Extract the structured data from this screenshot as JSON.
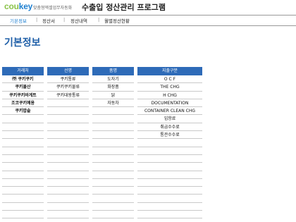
{
  "header": {
    "logo_main": "cou",
    "logo_accent": "key",
    "tagline": "맞춤형엑셀업무자동화",
    "title": "수출입 정산관리 프로그램"
  },
  "nav": {
    "items": [
      {
        "label": "기본정보",
        "active": true
      },
      {
        "label": "정산서"
      },
      {
        "label": "정산내역"
      },
      {
        "label": "월별정산현황"
      }
    ],
    "separator": "|"
  },
  "page": {
    "title": "기본정보"
  },
  "tables": [
    {
      "header": "거래처",
      "rows": [
        "㈜ 쿠키쿠키",
        "쿠키몰산",
        "쿠키쿠키바게트",
        "조코쿠키예용",
        "쿠키밥솥",
        "",
        "",
        "",
        "",
        "",
        "",
        "",
        "",
        "",
        "",
        "",
        "",
        ""
      ]
    },
    {
      "header": "선명",
      "rows": [
        "쿠키통류",
        "쿠키쿠키물류",
        "쿠키대왕통류",
        "",
        "",
        "",
        "",
        "",
        "",
        "",
        "",
        "",
        "",
        "",
        "",
        "",
        "",
        ""
      ]
    },
    {
      "header": "품명",
      "rows": [
        "도자기",
        "화장품",
        "닭",
        "자동차",
        "",
        "",
        "",
        "",
        "",
        "",
        "",
        "",
        "",
        "",
        "",
        "",
        "",
        ""
      ]
    },
    {
      "header": "지출구분",
      "rows": [
        "O C F",
        "THE CHG",
        "H CHG",
        "DOCUMENTATION",
        "CONTAINER CLEAN CHG",
        "입항료",
        "취급수수료",
        "통관수수료",
        "",
        "",
        "",
        "",
        "",
        "",
        "",
        "",
        "",
        ""
      ]
    }
  ]
}
